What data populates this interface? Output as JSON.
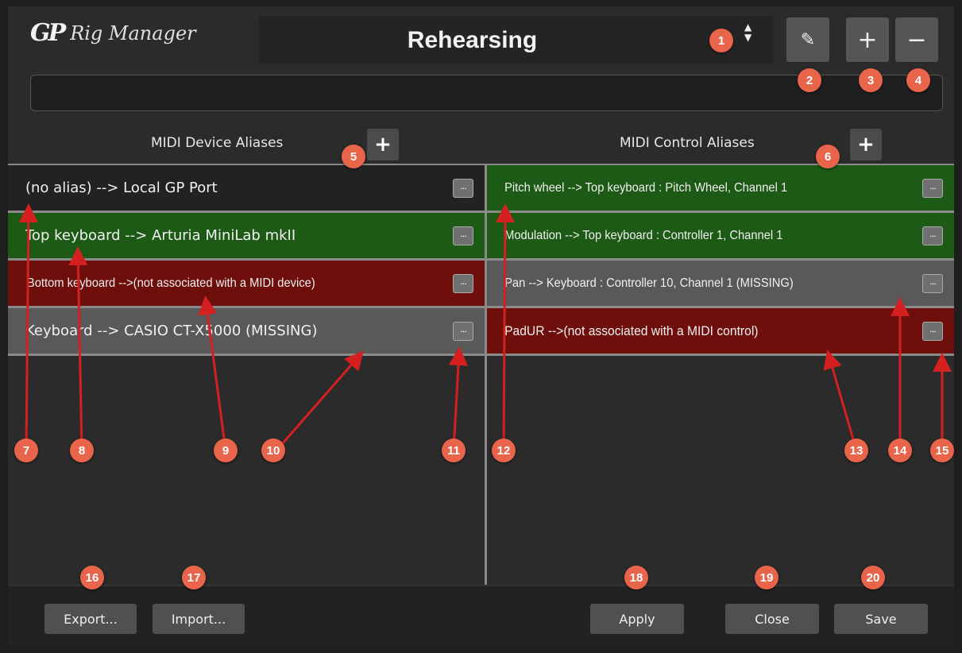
{
  "app": {
    "logo_mark": "GP",
    "logo_text": "Rig Manager"
  },
  "rig": {
    "name": "Rehearsing",
    "arrows_up": "▲",
    "arrows_down": "▼"
  },
  "toolbar": {
    "edit_icon": "✎",
    "add_label": "+",
    "remove_label": "−"
  },
  "device_aliases": {
    "title": "MIDI Device Aliases",
    "add_label": "+",
    "rows": [
      {
        "text": "(no alias) --> Local GP Port",
        "state": "neutral"
      },
      {
        "text": "Top keyboard --> Arturia MiniLab mkII",
        "state": "green"
      },
      {
        "text": "Bottom keyboard -->(not associated with a MIDI device)",
        "state": "red"
      },
      {
        "text": "Keyboard --> CASIO CT-X5000 (MISSING)",
        "state": "grey"
      }
    ]
  },
  "control_aliases": {
    "title": "MIDI Control Aliases",
    "add_label": "+",
    "rows": [
      {
        "text": "Pitch wheel --> Top keyboard : Pitch Wheel, Channel 1",
        "state": "green"
      },
      {
        "text": "Modulation --> Top keyboard : Controller 1, Channel 1",
        "state": "green"
      },
      {
        "text": "Pan --> Keyboard : Controller 10, Channel 1 (MISSING)",
        "state": "grey"
      },
      {
        "text": "PadUR -->(not associated with a MIDI control)",
        "state": "red"
      }
    ]
  },
  "more_label": "···",
  "buttons": {
    "export": "Export...",
    "import": "Import...",
    "apply": "Apply",
    "close": "Close",
    "save": "Save"
  },
  "badges": [
    "1",
    "2",
    "3",
    "4",
    "5",
    "6",
    "7",
    "8",
    "9",
    "10",
    "11",
    "12",
    "13",
    "14",
    "15",
    "16",
    "17",
    "18",
    "19",
    "20"
  ],
  "colors": {
    "green_row": "#1d5a16",
    "red_row": "#6e0f0c",
    "grey_row": "#595959",
    "badge": "#e8644a",
    "arrow": "#d42020"
  }
}
